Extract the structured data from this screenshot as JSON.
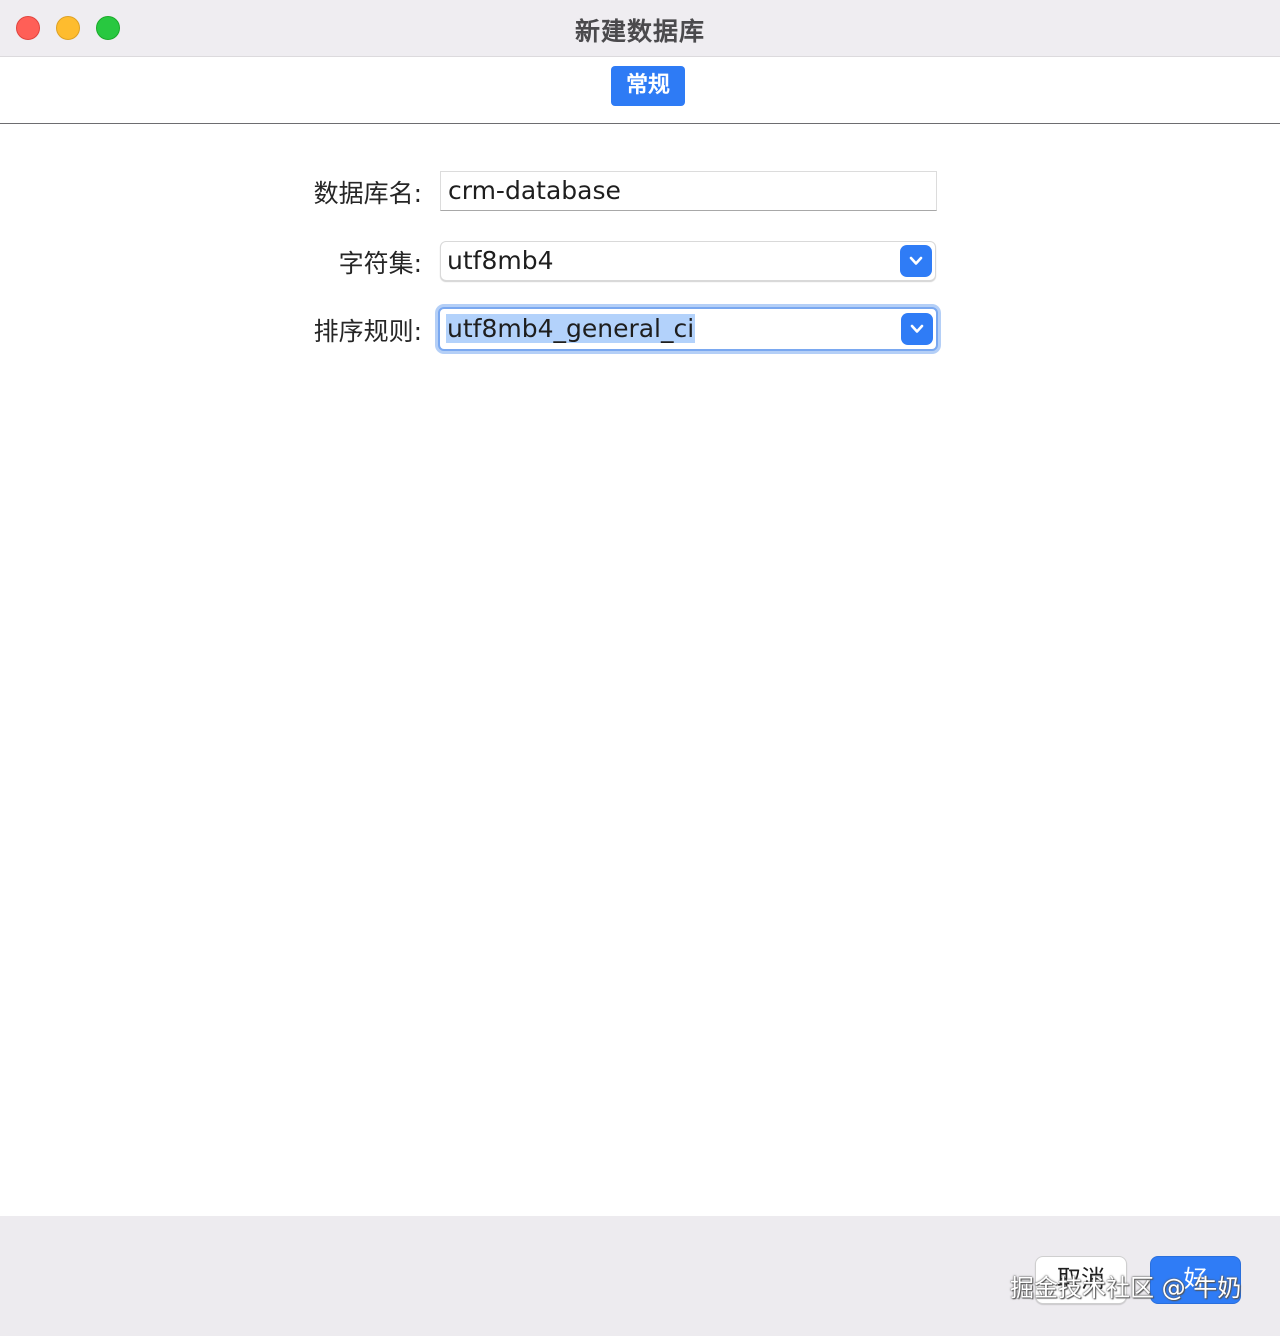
{
  "window": {
    "title": "新建数据库",
    "controls": {
      "close": "traffic-light-close",
      "minimize": "traffic-light-minimize",
      "maximize": "traffic-light-zoom"
    }
  },
  "tabs": [
    {
      "label": "常规",
      "active": true
    }
  ],
  "form": {
    "name": {
      "label": "数据库名:",
      "value": "crm-database"
    },
    "charset": {
      "label": "字符集:",
      "value": "utf8mb4",
      "icon": "chevron-down-icon"
    },
    "collation": {
      "label": "排序规则:",
      "value": "utf8mb4_general_ci",
      "icon": "chevron-down-icon",
      "focused": true,
      "selected_text": true
    }
  },
  "footer": {
    "cancel_label": "取消",
    "ok_label": "好"
  },
  "watermark": "掘金技术社区 @ 牛奶",
  "colors": {
    "accent": "#2f7cf6",
    "titlebar": "#efedf1",
    "footer": "#edebef",
    "close": "#ff5f57",
    "minimize": "#febc2e",
    "maximize": "#28c840",
    "selection": "#b3d2fb"
  }
}
